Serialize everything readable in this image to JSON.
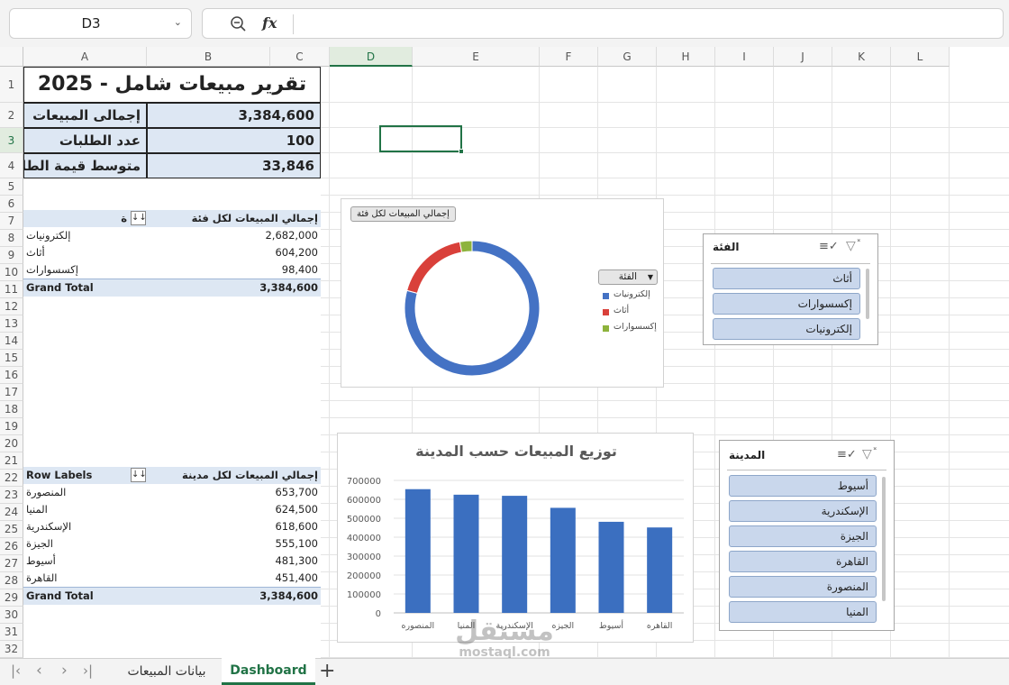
{
  "formula_bar": {
    "name_box": "D3",
    "fx_label": "fx"
  },
  "columns": [
    "A",
    "B",
    "C",
    "D",
    "E",
    "F",
    "G",
    "H",
    "I",
    "J",
    "K",
    "L"
  ],
  "rows": [
    "1",
    "2",
    "3",
    "4",
    "5",
    "6",
    "7",
    "8",
    "9",
    "10",
    "11",
    "12",
    "13",
    "14",
    "15",
    "16",
    "17",
    "18",
    "19",
    "20",
    "21",
    "22",
    "23",
    "24",
    "25",
    "26",
    "27",
    "28",
    "29",
    "30",
    "31",
    "32"
  ],
  "summary": {
    "title": "تقرير مبيعات شامل - 2025",
    "total_sales_label": "إجمالى المبيعات",
    "total_sales_value": "3,384,600",
    "orders_label": "عدد الطلبات",
    "orders_value": "100",
    "avg_label": "متوسط قيمة الطلب",
    "avg_value": "33,846"
  },
  "pivot_category": {
    "value_header": "إجمالي المبيعات لكل فئة",
    "row_header": "ة",
    "rows": [
      {
        "label": "إلكترونيات",
        "value": "2,682,000"
      },
      {
        "label": "أثاث",
        "value": "604,200"
      },
      {
        "label": "إكسسوارات",
        "value": "98,400"
      }
    ],
    "total_label": "Grand Total",
    "total_value": "3,384,600"
  },
  "pivot_city": {
    "row_header": "Row Labels",
    "value_header": "إجمالي المبيعات لكل مدينة",
    "rows": [
      {
        "label": "المنصورة",
        "value": "653,700"
      },
      {
        "label": "المنيا",
        "value": "624,500"
      },
      {
        "label": "الإسكندرية",
        "value": "618,600"
      },
      {
        "label": "الجيزة",
        "value": "555,100"
      },
      {
        "label": "أسيوط",
        "value": "481,300"
      },
      {
        "label": "القاهرة",
        "value": "451,400"
      }
    ],
    "total_label": "Grand Total",
    "total_value": "3,384,600"
  },
  "donut_chart": {
    "field_button": "إجمالي المبيعات لكل فئة",
    "legend_button": "الفئة"
  },
  "bar_chart": {
    "title": "توزيع المبيعات حسب المدينة"
  },
  "chart_data": [
    {
      "type": "pie",
      "style": "donut",
      "categories": [
        "إلكترونيات",
        "أثاث",
        "إكسسوارات"
      ],
      "values": [
        2682000,
        604200,
        98400
      ],
      "colors": [
        "#4472c4",
        "#d9403a",
        "#8db33c"
      ],
      "legend": "right"
    },
    {
      "type": "bar",
      "title": "توزيع المبيعات حسب المدينة",
      "categories": [
        "المنصوره",
        "المنيا",
        "الإسكندرية",
        "الجيزه",
        "أسيوط",
        "القاهره"
      ],
      "values": [
        653700,
        624500,
        618600,
        555100,
        481300,
        451400
      ],
      "yticks": [
        "0",
        "100000",
        "200000",
        "300000",
        "400000",
        "500000",
        "600000",
        "700000"
      ],
      "ylim": [
        0,
        700000
      ],
      "grid": true,
      "color": "#3b6fc0"
    }
  ],
  "slicer_category": {
    "title": "الفئة",
    "items": [
      "أثاث",
      "إكسسوارات",
      "إلكترونيات"
    ]
  },
  "slicer_city": {
    "title": "المدينة",
    "items": [
      "أسيوط",
      "الإسكندرية",
      "الجيزة",
      "القاهرة",
      "المنصورة",
      "المنيا"
    ]
  },
  "sheet_tabs": {
    "tab1": "بيانات المبيعات",
    "tab2": "Dashboard"
  },
  "watermark": {
    "logo": "مستقل",
    "url": "mostaql.com"
  }
}
